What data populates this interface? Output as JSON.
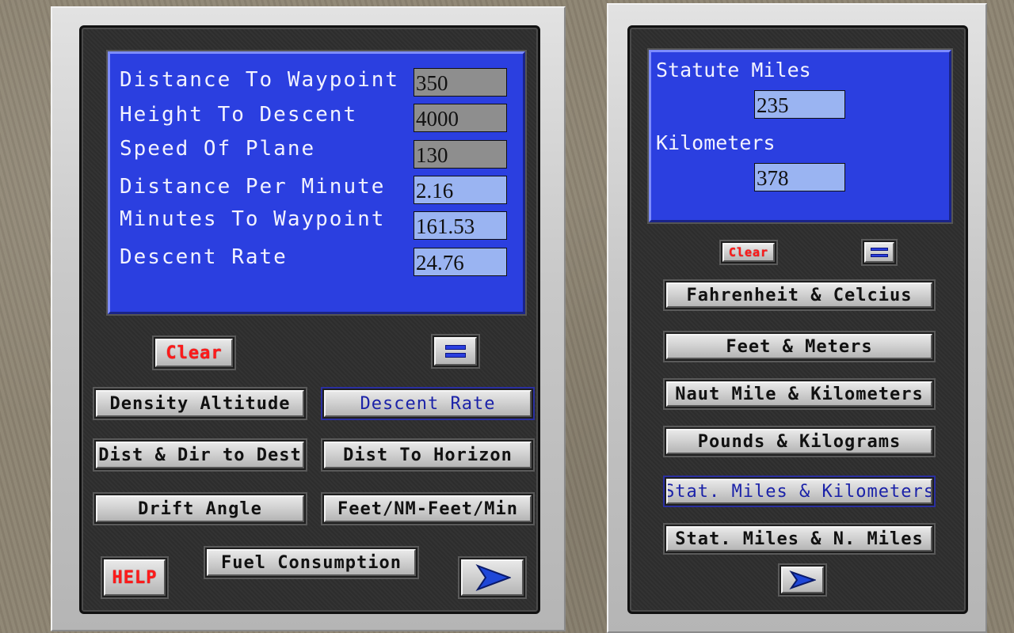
{
  "left_panel": {
    "fields": [
      {
        "label": "Distance To Waypoint",
        "value": "350",
        "kind": "input"
      },
      {
        "label": "Height To Descent",
        "value": "4000",
        "kind": "input"
      },
      {
        "label": "Speed Of Plane",
        "value": "130",
        "kind": "input"
      },
      {
        "label": "Distance Per Minute",
        "value": "2.16",
        "kind": "output"
      },
      {
        "label": "Minutes To Waypoint",
        "value": "161.53",
        "kind": "output"
      },
      {
        "label": "Descent Rate",
        "value": "24.76",
        "kind": "output"
      }
    ],
    "clear_label": "Clear",
    "equals_icon": "equals-icon",
    "buttons": {
      "density_altitude": "Density Altitude",
      "descent_rate": "Descent Rate",
      "dist_dir_dest": "Dist & Dir to Dest",
      "dist_horizon": "Dist To Horizon",
      "drift_angle": "Drift Angle",
      "feet_nm": "Feet/NM-Feet/Min",
      "fuel_consumption": "Fuel Consumption"
    },
    "help_label": "HELP",
    "next_icon": "arrow-right-icon",
    "active_tool": "Descent Rate"
  },
  "right_panel": {
    "label_1": "Statute Miles",
    "value_1": "235",
    "label_2": "Kilometers",
    "value_2": "378",
    "clear_label": "Clear",
    "equals_icon": "equals-icon",
    "conversions": [
      "Fahrenheit & Celcius",
      "Feet & Meters",
      "Naut Mile & Kilometers",
      "Pounds & Kilograms",
      "Stat. Miles & Kilometers",
      "Stat. Miles & N. Miles"
    ],
    "active_conversion": "Stat. Miles & Kilometers",
    "next_icon": "arrow-right-icon"
  },
  "colors": {
    "lcd_blue": "#2b3fe0",
    "output_field": "#9ab4f2",
    "input_field": "#8e8e8e",
    "clear_red": "#ff1a1a",
    "active_text": "#1b22a8"
  }
}
